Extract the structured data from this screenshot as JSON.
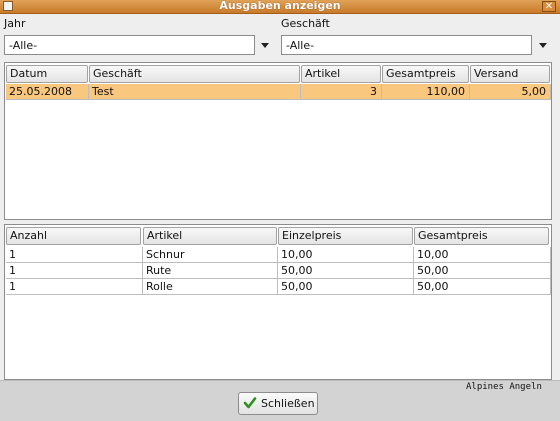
{
  "window": {
    "title": "Ausgaben anzeigen"
  },
  "filters": {
    "year_label": "Jahr",
    "year_value": "-Alle-",
    "shop_label": "Geschäft",
    "shop_value": "-Alle-"
  },
  "purchases": {
    "columns": [
      "Datum",
      "Geschäft",
      "Artikel",
      "Gesamtpreis",
      "Versand"
    ],
    "rows": [
      [
        "25.05.2008",
        "Test",
        "3",
        "110,00",
        "5,00"
      ]
    ]
  },
  "items": {
    "columns": [
      "Anzahl",
      "Artikel",
      "Einzelpreis",
      "Gesamtpreis"
    ],
    "rows": [
      [
        "1",
        "Schnur",
        "10,00",
        "10,00"
      ],
      [
        "1",
        "Rute",
        "50,00",
        "50,00"
      ],
      [
        "1",
        "Rolle",
        "50,00",
        "50,00"
      ]
    ]
  },
  "buttons": {
    "close_label": "Schließen"
  },
  "background": {
    "label": "Alpines Angeln"
  },
  "colors": {
    "titlebar": "#d08a3d",
    "selection": "#f9c77e"
  }
}
